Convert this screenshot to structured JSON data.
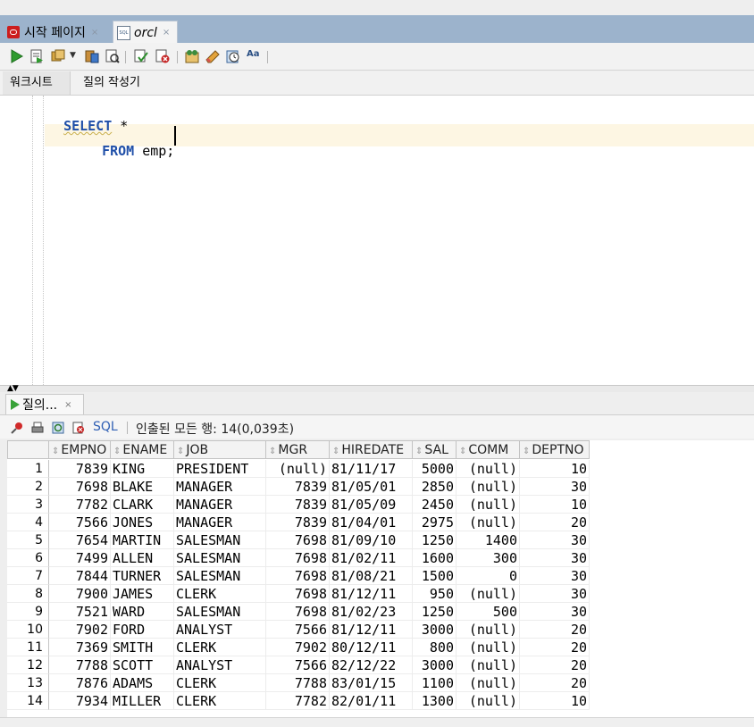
{
  "tabs": [
    {
      "label": "시작 페이지",
      "close": "×"
    },
    {
      "label": "orcl",
      "close": "×"
    }
  ],
  "subtabs": {
    "worksheet": "워크시트",
    "query_builder": "질의 작성기"
  },
  "editor": {
    "line1_kw": "SELECT",
    "line1_rest": " *",
    "line2_kw": "FROM",
    "line2_rest": " emp;"
  },
  "results": {
    "tab_label": "질의...",
    "tab_close": "×",
    "sql_link": "SQL",
    "status": "인출된 모든 행: 14(0,039초)",
    "columns": [
      "EMPNO",
      "ENAME",
      "JOB",
      "MGR",
      "HIREDATE",
      "SAL",
      "COMM",
      "DEPTNO"
    ],
    "rows": [
      [
        "1",
        "7839",
        "KING",
        "PRESIDENT",
        "(null)",
        "81/11/17",
        "5000",
        "(null)",
        "10"
      ],
      [
        "2",
        "7698",
        "BLAKE",
        "MANAGER",
        "7839",
        "81/05/01",
        "2850",
        "(null)",
        "30"
      ],
      [
        "3",
        "7782",
        "CLARK",
        "MANAGER",
        "7839",
        "81/05/09",
        "2450",
        "(null)",
        "10"
      ],
      [
        "4",
        "7566",
        "JONES",
        "MANAGER",
        "7839",
        "81/04/01",
        "2975",
        "(null)",
        "20"
      ],
      [
        "5",
        "7654",
        "MARTIN",
        "SALESMAN",
        "7698",
        "81/09/10",
        "1250",
        "1400",
        "30"
      ],
      [
        "6",
        "7499",
        "ALLEN",
        "SALESMAN",
        "7698",
        "81/02/11",
        "1600",
        "300",
        "30"
      ],
      [
        "7",
        "7844",
        "TURNER",
        "SALESMAN",
        "7698",
        "81/08/21",
        "1500",
        "0",
        "30"
      ],
      [
        "8",
        "7900",
        "JAMES",
        "CLERK",
        "7698",
        "81/12/11",
        "950",
        "(null)",
        "30"
      ],
      [
        "9",
        "7521",
        "WARD",
        "SALESMAN",
        "7698",
        "81/02/23",
        "1250",
        "500",
        "30"
      ],
      [
        "10",
        "7902",
        "FORD",
        "ANALYST",
        "7566",
        "81/12/11",
        "3000",
        "(null)",
        "20"
      ],
      [
        "11",
        "7369",
        "SMITH",
        "CLERK",
        "7902",
        "80/12/11",
        "800",
        "(null)",
        "20"
      ],
      [
        "12",
        "7788",
        "SCOTT",
        "ANALYST",
        "7566",
        "82/12/22",
        "3000",
        "(null)",
        "20"
      ],
      [
        "13",
        "7876",
        "ADAMS",
        "CLERK",
        "7788",
        "83/01/15",
        "1100",
        "(null)",
        "20"
      ],
      [
        "14",
        "7934",
        "MILLER",
        "CLERK",
        "7782",
        "82/01/11",
        "1300",
        "(null)",
        "10"
      ]
    ]
  },
  "colors": {
    "keyword": "#1f4fa8",
    "tab_strip": "#9cb3cc",
    "run_green": "#38a238"
  }
}
